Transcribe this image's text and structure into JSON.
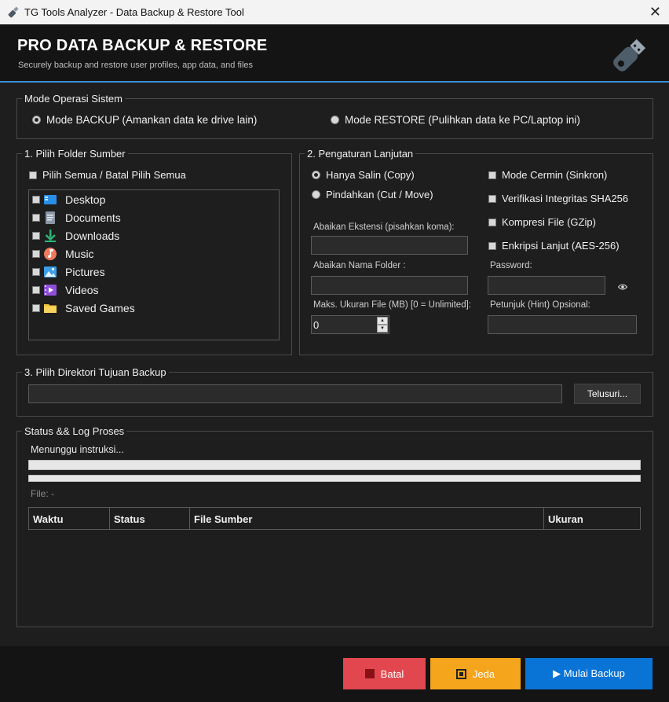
{
  "window": {
    "title": "TG Tools Analyzer - Data Backup & Restore Tool",
    "close": "✕"
  },
  "header": {
    "title": "PRO DATA BACKUP & RESTORE",
    "subtitle": "Securely backup and restore user profiles, app data, and files"
  },
  "mode": {
    "group_label": "Mode Operasi Sistem",
    "backup_label": "Mode BACKUP (Amankan data ke drive lain)",
    "restore_label": "Mode RESTORE (Pulihkan data ke PC/Laptop ini)",
    "selected": "backup"
  },
  "source": {
    "group_label": "1. Pilih Folder Sumber",
    "select_all_label": "Pilih Semua / Batal Pilih Semua",
    "folders": [
      {
        "label": "Desktop",
        "icon": "desktop-folder-icon"
      },
      {
        "label": "Documents",
        "icon": "documents-folder-icon"
      },
      {
        "label": "Downloads",
        "icon": "downloads-folder-icon"
      },
      {
        "label": "Music",
        "icon": "music-folder-icon"
      },
      {
        "label": "Pictures",
        "icon": "pictures-folder-icon"
      },
      {
        "label": "Videos",
        "icon": "videos-folder-icon"
      },
      {
        "label": "Saved Games",
        "icon": "saved-games-folder-icon"
      }
    ]
  },
  "advanced": {
    "group_label": "2. Pengaturan Lanjutan",
    "copy_label": "Hanya Salin (Copy)",
    "move_label": "Pindahkan (Cut / Move)",
    "copy_selected": true,
    "mirror_label": "Mode Cermin (Sinkron)",
    "verify_label": "Verifikasi Integritas SHA256",
    "compress_label": "Kompresi File (GZip)",
    "encrypt_label": "Enkripsi Lanjut (AES-256)",
    "ignore_ext_label": "Abaikan Ekstensi (pisahkan koma):",
    "ignore_ext_value": "",
    "ignore_folder_label": "Abaikan Nama Folder :",
    "ignore_folder_value": "",
    "max_size_label": "Maks. Ukuran File (MB) [0 = Unlimited]:",
    "max_size_value": "0",
    "password_label": "Password:",
    "password_value": "",
    "hint_label": "Petunjuk (Hint) Opsional:",
    "hint_value": ""
  },
  "target": {
    "group_label": "3. Pilih Direktori Tujuan Backup",
    "path_value": "",
    "browse_label": "Telusuri..."
  },
  "status": {
    "group_label": "Status && Log Proses",
    "message": "Menunggu instruksi...",
    "progress_total": 0,
    "progress_file": 0,
    "file_label": "File: -",
    "columns": [
      "Waktu",
      "Status",
      "File Sumber",
      "Ukuran"
    ]
  },
  "footer": {
    "cancel_label": "Batal",
    "pause_label": "Jeda",
    "start_label": "▶  Mulai Backup"
  },
  "colors": {
    "accent": "#3d8fd6",
    "cancel": "#e2474f",
    "pause": "#f4a51c",
    "start": "#0a74d6"
  }
}
